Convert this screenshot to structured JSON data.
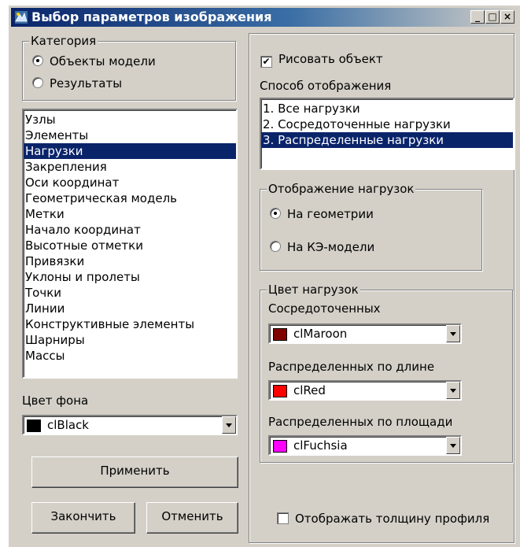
{
  "window": {
    "title": "Выбор параметров изображения",
    "minimize_label": "_",
    "maximize_label": "□",
    "close_label": "×"
  },
  "category": {
    "legend": "Категория",
    "options": [
      "Объекты модели",
      "Результаты"
    ],
    "selected": "Объекты модели"
  },
  "objects_list": {
    "items": [
      "Узлы",
      "Элементы",
      "Нагрузки",
      "Закрепления",
      "Оси координат",
      "Геометрическая модель",
      "Метки",
      "Начало координат",
      "Высотные отметки",
      "Привязки",
      "Уклоны и пролеты",
      "Точки",
      "Линии",
      "Конструктивные элементы",
      "Шарниры",
      "Массы"
    ],
    "selected": "Нагрузки"
  },
  "background": {
    "label": "Цвет фона",
    "value": "clBlack",
    "color": "#000000"
  },
  "buttons": {
    "apply": "Применить",
    "finish": "Закончить",
    "cancel": "Отменить"
  },
  "draw_object": {
    "label": "Рисовать объект",
    "checked": true,
    "check_mark": "✔"
  },
  "display_mode": {
    "label": "Способ отображения",
    "items": [
      "1. Все нагрузки",
      "2. Сосредоточенные нагрузки",
      "3. Распределенные нагрузки"
    ],
    "selected": "3. Распределенные нагрузки"
  },
  "load_display": {
    "legend": "Отображение нагрузок",
    "options": [
      "На геометрии",
      "На КЭ-модели"
    ],
    "selected": "На геометрии"
  },
  "load_color": {
    "legend": "Цвет нагрузок",
    "concentrated": {
      "label": "Сосредоточенных",
      "value": "clMaroon",
      "color": "#800000"
    },
    "distributed_length": {
      "label": "Распределенных по длине",
      "value": "clRed",
      "color": "#ff0000"
    },
    "distributed_area": {
      "label": "Распределенных по площади",
      "value": "clFuchsia",
      "color": "#ff00ff"
    }
  },
  "profile_thickness": {
    "label": "Отображать толщину профиля",
    "checked": false
  },
  "colors": {
    "selection": "#0a246a",
    "face": "#d4d0c8"
  }
}
